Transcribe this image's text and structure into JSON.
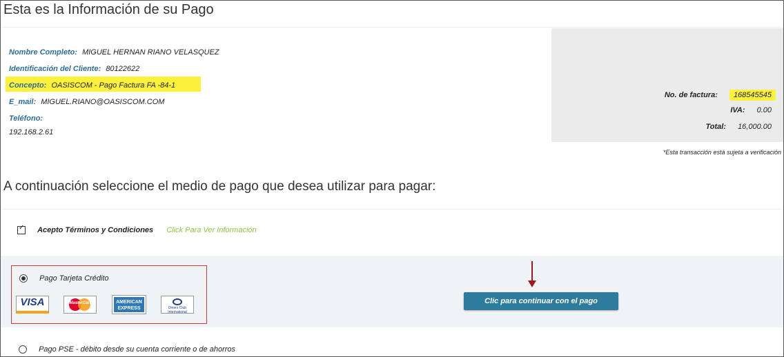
{
  "header": {
    "title": "Esta es la Información de su Pago"
  },
  "client": {
    "name_label": "Nombre Completo:",
    "name_value": "MIGUEL HERNAN RIANO VELASQUEZ",
    "id_label": "Identificación del Cliente:",
    "id_value": "80122622",
    "concept_label": "Concepto:",
    "concept_value": "OASISCOM - Pago Factura FA -84-1",
    "email_label": "E_mail:",
    "email_value": "MIGUEL.RIANO@OASISCOM.COM",
    "phone_label": "Teléfono:",
    "phone_value": "192.168.2.61"
  },
  "summary": {
    "invoice_label": "No. de factura:",
    "invoice_value": "168545545",
    "iva_label": "IVA:",
    "iva_value": "0.00",
    "total_label": "Total:",
    "total_value": "16,000.00",
    "note": "*Esta transacción está sujeta a verificación"
  },
  "payment": {
    "heading": "A continuación seleccione el medio de pago que desea utilizar para pagar:",
    "terms_label": "Acepto Términos y Condiciones",
    "terms_checked": true,
    "terms_link": "Click Para Ver Información",
    "card_option_label": "Pago Tarjeta Crédito",
    "card_option_selected": true,
    "card_logos": {
      "visa": "VISA",
      "mastercard": "MasterCard",
      "amex_line1": "AMERICAN",
      "amex_line2": "EXPRESS",
      "diners": "Diners Club International"
    },
    "continue_button": "Clic para continuar con el pago",
    "pse_option_label": "Pago PSE - débito desde su cuenta corriente o de ahorros",
    "pse_option_selected": false
  },
  "colors": {
    "label_blue": "#2b6f99",
    "highlight": "#fbf03a",
    "link_green": "#8cc63f",
    "button": "#2d7c9d",
    "selection_border": "#d23a3a",
    "arrow": "#a01818"
  }
}
